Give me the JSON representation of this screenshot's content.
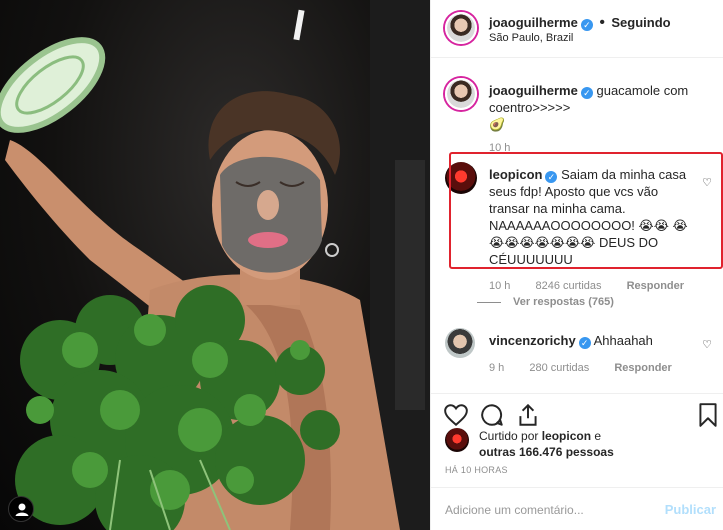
{
  "post": {
    "author": "joaoguilherme",
    "follow_status": "Seguindo",
    "separator": "•",
    "location": "São Paulo, Brazil"
  },
  "caption": {
    "username": "joaoguilherme",
    "text": "guacamole com coentro>>>>>",
    "emoji": "🥑",
    "time": "10 h"
  },
  "comments": [
    {
      "username": "leopicon",
      "text": "Saiam da minha casa seus fdp! Aposto que vcs vão transar na minha cama. NAAAAAAOOOOOOOO! 😭😭 😭😭😭😭😭😭😭😭 DEUS DO CÉUUUUUUU",
      "time": "10 h",
      "likes": "8246 curtidas",
      "reply": "Responder",
      "view_replies": "Ver respostas (765)"
    },
    {
      "username": "vincenzorichy",
      "text": "Ahhaahah",
      "time": "9 h",
      "likes": "280 curtidas",
      "reply": "Responder"
    }
  ],
  "likes": {
    "prefix": "Curtido por",
    "user": "leopicon",
    "suffix": "e",
    "others": "outras 166.476 pessoas"
  },
  "timestamp": "HÁ 10 HORAS",
  "add_comment": {
    "placeholder": "Adicione um comentário...",
    "publish": "Publicar"
  },
  "colors": {
    "verified": "#3897f0",
    "highlight": "#e0232e",
    "publish": "#b2dffc"
  },
  "icons": [
    "heart-icon",
    "comment-icon",
    "share-icon",
    "bookmark-icon",
    "user-tag-icon",
    "verified-icon"
  ]
}
